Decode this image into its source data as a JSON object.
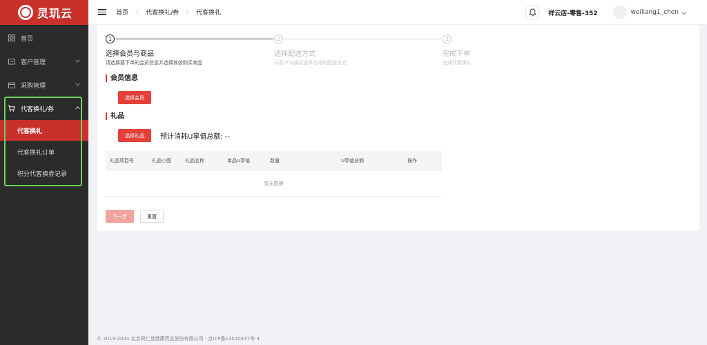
{
  "brand": {
    "name": "灵玑云",
    "accent": "#c9302c",
    "highlight": "#6cd35b"
  },
  "sidebar": {
    "items": [
      {
        "label": "首页",
        "icon": "grid-icon"
      },
      {
        "label": "客户管理",
        "icon": "customer-icon"
      },
      {
        "label": "采购管理",
        "icon": "purchase-icon"
      },
      {
        "label": "代客换礼/券",
        "icon": "cart-icon"
      }
    ],
    "sub_items": [
      {
        "label": "代客换礼",
        "active": true
      },
      {
        "label": "代客换礼订单"
      },
      {
        "label": "积分代客换券记录"
      }
    ]
  },
  "header": {
    "breadcrumb": [
      "首页",
      "代客换礼/券",
      "代客换礼"
    ],
    "store": "祥云店-零售-352",
    "user": "weiliang1_chen"
  },
  "steps": [
    {
      "num": "1",
      "title": "选择会员与商品",
      "desc": "请选择要下单的会员信息并选择其欲购买商品"
    },
    {
      "num": "2",
      "title": "选择配送方式",
      "desc": "与客户沟通并选择合适的配送方式"
    },
    {
      "num": "3",
      "title": "完成下单",
      "desc": "完成代客换礼"
    }
  ],
  "member": {
    "title": "会员信息",
    "button": "选择会员"
  },
  "gift": {
    "title": "礼品",
    "button": "选择礼品",
    "estimate": "预计消耗U享值总额: --"
  },
  "table": {
    "columns": [
      "礼品项目号",
      "礼品小图",
      "礼品名称",
      "单品U享值",
      "数量",
      "U享值总额",
      "操作"
    ],
    "empty": "暂无数据"
  },
  "actions": {
    "next": "下一步",
    "reset": "重置"
  },
  "footer": {
    "text": "© 2019-2024 北京同仁堂健康药业股份有限公司 · 京ICP备13010437号-4"
  }
}
